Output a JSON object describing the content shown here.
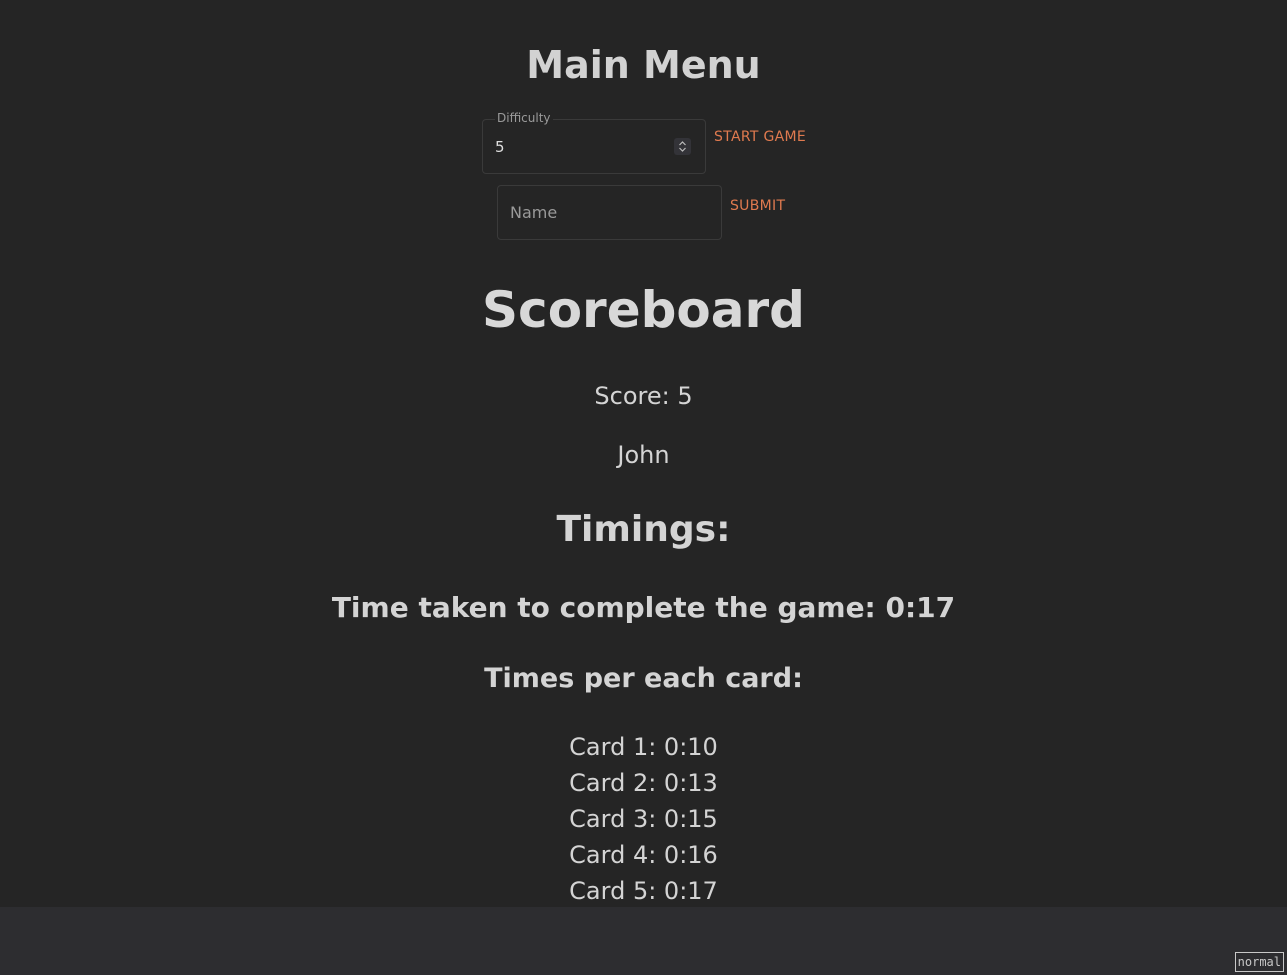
{
  "menu": {
    "title": "Main Menu",
    "difficulty_label": "Difficulty",
    "difficulty_value": "5",
    "start_label": "START GAME",
    "name_placeholder": "Name",
    "name_value": "",
    "submit_label": "SUBMIT"
  },
  "scoreboard": {
    "title": "Scoreboard",
    "score": "Score: 5",
    "player": "John",
    "timings_title": "Timings:",
    "total_time": "Time taken to complete the game: 0:17",
    "per_card_title": "Times per each card:",
    "cards": [
      "Card 1: 0:10",
      "Card 2: 0:13",
      "Card 3: 0:15",
      "Card 4: 0:16",
      "Card 5: 0:17"
    ]
  },
  "status": {
    "mode": "normal"
  },
  "colors": {
    "background": "#252525",
    "accent": "#e07a4f",
    "footer": "#2d2d30"
  }
}
